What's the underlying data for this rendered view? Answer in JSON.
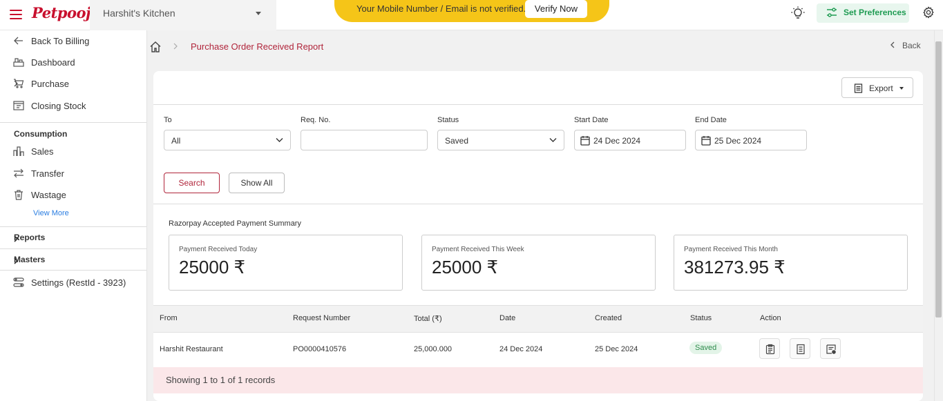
{
  "header": {
    "logo": "Petpooja",
    "outlet": "Harshit's Kitchen",
    "verify_message": "Your Mobile Number / Email is not verified.",
    "verify_button": "Verify Now",
    "preferences_button": "Set Preferences"
  },
  "sidebar": {
    "back_to_billing": "Back To Billing",
    "dashboard": "Dashboard",
    "purchase": "Purchase",
    "closing_stock": "Closing Stock",
    "consumption_heading": "Consumption",
    "sales": "Sales",
    "transfer": "Transfer",
    "wastage": "Wastage",
    "view_more": "View More",
    "reports": "Reports",
    "masters": "Masters",
    "settings": "Settings (RestId - 3923)"
  },
  "breadcrumb": {
    "title": "Purchase Order Received Report",
    "back": "Back"
  },
  "toolbar": {
    "export": "Export"
  },
  "filters": {
    "to_label": "To",
    "to_value": "All",
    "req_label": "Req. No.",
    "req_value": "",
    "status_label": "Status",
    "status_value": "Saved",
    "start_label": "Start Date",
    "start_value": "24 Dec 2024",
    "end_label": "End Date",
    "end_value": "25 Dec 2024",
    "search": "Search",
    "show_all": "Show All"
  },
  "summary": {
    "title": "Razorpay Accepted Payment Summary",
    "today_label": "Payment Received Today",
    "today_value": "25000 ₹",
    "week_label": "Payment Received This Week",
    "week_value": "25000 ₹",
    "month_label": "Payment Received This Month",
    "month_value": "381273.95 ₹"
  },
  "table": {
    "columns": [
      "From",
      "Request Number",
      "Total (₹)",
      "Date",
      "Created",
      "Status",
      "Action"
    ],
    "rows": [
      {
        "from": "Harshit Restaurant",
        "request_number": "PO0000410576",
        "total": "25,000.000",
        "date": "24 Dec 2024",
        "created": "25 Dec 2024",
        "status": "Saved"
      }
    ],
    "footer": "Showing 1 to 1 of 1 records"
  }
}
